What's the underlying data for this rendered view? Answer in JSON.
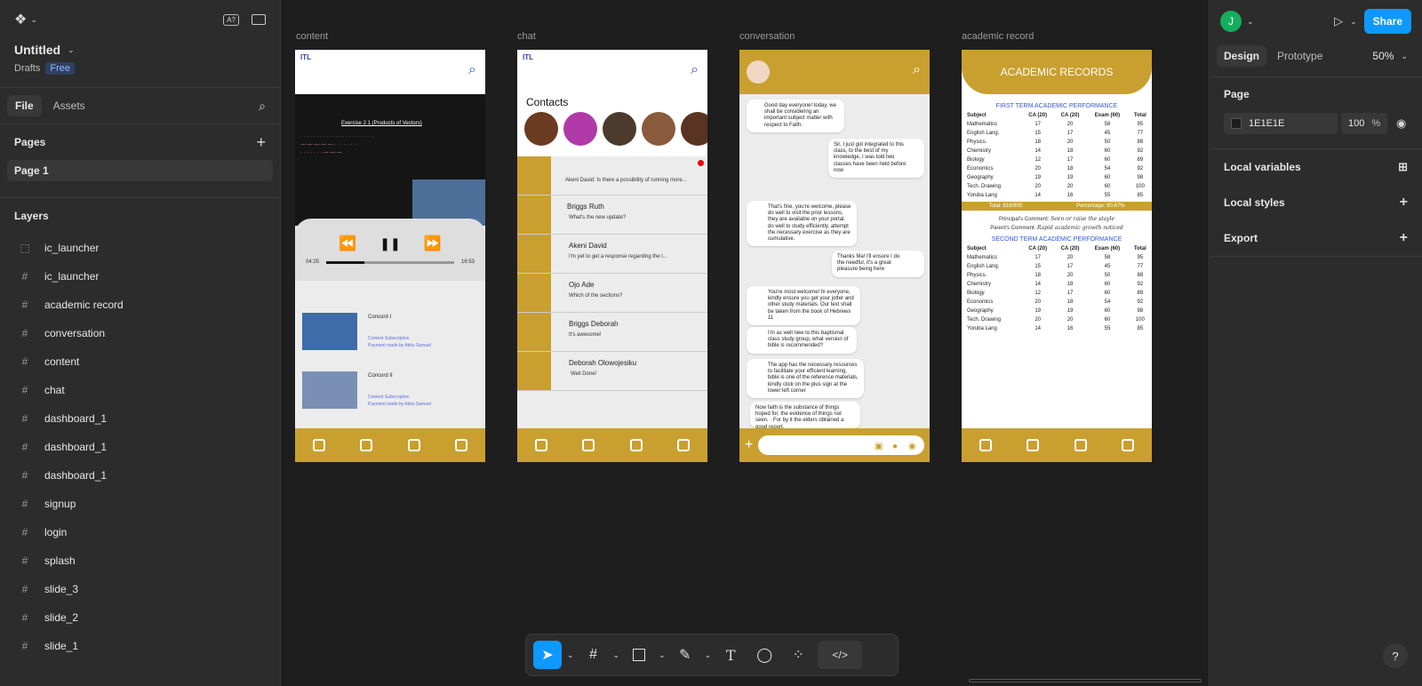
{
  "file": {
    "name": "Untitled",
    "location": "Drafts",
    "plan_badge": "Free"
  },
  "left_tabs": [
    "File",
    "Assets"
  ],
  "pages_header": "Pages",
  "pages": [
    "Page 1"
  ],
  "layers_header": "Layers",
  "layers": [
    "ic_launcher",
    "ic_launcher",
    "academic record",
    "conversation",
    "content",
    "chat",
    "dashboard_1",
    "dashboard_1",
    "dashboard_1",
    "signup",
    "login",
    "splash",
    "slide_3",
    "slide_2",
    "slide_1"
  ],
  "frames": {
    "content": {
      "label": "content",
      "video_title": "Exercise 2.1 (Products of Vectors)",
      "time_start": "04:25",
      "time_end": "16:53",
      "progress": 0.3,
      "items": [
        {
          "title": "Concord I",
          "sub1": "Content Subscription",
          "sub2": "Payment made by Akitu Samuel"
        },
        {
          "title": "Concord II",
          "sub1": "Content Subscription",
          "sub2": "Payment made by Akitu Samuel"
        }
      ]
    },
    "chat": {
      "label": "chat",
      "contacts_title": "Contacts",
      "items": [
        {
          "name": "",
          "msg": "Akeni David: Is there a possibility of running more..."
        },
        {
          "name": "Briggs Ruth",
          "msg": "What's the new update?"
        },
        {
          "name": "Akeni David",
          "msg": "I'm yet to get a response regarding the l..."
        },
        {
          "name": "Ojo Ade",
          "msg": "Which of the sections?"
        },
        {
          "name": "Briggs Deborah",
          "msg": "It's awesome!"
        },
        {
          "name": "Deborah Olowojesiku",
          "msg": "Well Done!"
        }
      ]
    },
    "conversation": {
      "label": "conversation",
      "messages": [
        "Good day everyone! today, we shall be considering an important subject matter with respect to Faith.",
        "Sir, I just got integrated to this class, to the best of my knowledge, I was told two classes have been held before now",
        "That's fine, you're welcome, please do well to visit the prior lessons, they are available on your portal. do well to study efficiently, attempt the necessary exercise as they are cumulative.",
        "Thanks Ma! I'll ensure I do the needful, it's a great pleasure being here",
        "You're most welcome! hi everyone, kindly ensure you get your jotter and other study materials. Our text shall be taken from the book of Hebrews 11",
        "I'm as well new to this baptismal class study group, what version of bible is recommended?",
        "The app has the necessary resources to facilitate your efficient learning, bible is one of the reference materials, kindly click on the plus sign at the lower left corner",
        "Now faith is the substance of things hoped for, the evidence of things not seen. · For by it the elders obtained a good report."
      ]
    },
    "academic": {
      "label": "academic record",
      "title": "ACADEMIC RECORDS",
      "first_term": "FIRST TERM ACADEMIC PERFORMANCE",
      "second_term": "SECOND TERM ACADEMIC PERFORMANCE",
      "headers": [
        "Subject",
        "CA (20)",
        "CA (20)",
        "Exam (60)",
        "Total"
      ],
      "rows": [
        [
          "Mathematics",
          "17",
          "20",
          "58",
          "95"
        ],
        [
          "English Lang.",
          "15",
          "17",
          "45",
          "77"
        ],
        [
          "Physics.",
          "18",
          "20",
          "50",
          "88"
        ],
        [
          "Chemistry",
          "14",
          "18",
          "60",
          "92"
        ],
        [
          "Biology",
          "12",
          "17",
          "60",
          "89"
        ],
        [
          "Economics",
          "20",
          "18",
          "54",
          "92"
        ],
        [
          "Geography",
          "19",
          "19",
          "60",
          "98"
        ],
        [
          "Tech. Drawing",
          "20",
          "20",
          "60",
          "100"
        ],
        [
          "Yoruba Lang",
          "14",
          "16",
          "55",
          "85"
        ]
      ],
      "total": "Total: 816/900",
      "percentage": "Percentage: 90.67%",
      "principal_label": "Principal's Comment:",
      "principal_comment": "Seen or raise the stayle",
      "parent_label": "Parent's Comment:",
      "parent_comment": "Rapid academic growth noticed"
    }
  },
  "right_panel": {
    "avatar_initial": "J",
    "share": "Share",
    "tabs": [
      "Design",
      "Prototype"
    ],
    "zoom": "50%",
    "page_label": "Page",
    "bg_color": "1E1E1E",
    "bg_opacity": "100",
    "percent": "%",
    "sections": [
      "Local variables",
      "Local styles",
      "Export"
    ]
  },
  "colors": {
    "accent": "#0d99ff",
    "gold": "#c9a02f",
    "avatar": "#14ae5c"
  }
}
